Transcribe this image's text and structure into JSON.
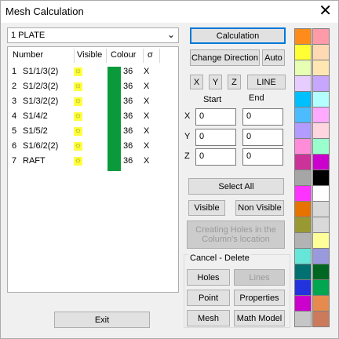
{
  "window": {
    "title": "Mesh Calculation",
    "close_symbol": "✕"
  },
  "plate_select": {
    "value": "1 PLATE"
  },
  "list": {
    "headers": {
      "number": "Number",
      "visible": "Visible",
      "colour": "Colour",
      "sigma": "σ"
    },
    "rows": [
      {
        "idx": "1",
        "name": "S1/1/3(2)",
        "colour_value": "36",
        "sigma": "X"
      },
      {
        "idx": "2",
        "name": "S1/2/3(2)",
        "colour_value": "36",
        "sigma": "X"
      },
      {
        "idx": "3",
        "name": "S1/3/2(2)",
        "colour_value": "36",
        "sigma": "X"
      },
      {
        "idx": "4",
        "name": "S1/4/2",
        "colour_value": "36",
        "sigma": "X"
      },
      {
        "idx": "5",
        "name": "S1/5/2",
        "colour_value": "36",
        "sigma": "X"
      },
      {
        "idx": "6",
        "name": "S1/6/2(2)",
        "colour_value": "36",
        "sigma": "X"
      },
      {
        "idx": "7",
        "name": "RAFT",
        "colour_value": "36",
        "sigma": "X"
      }
    ],
    "swatch_color": "#0b9a3b"
  },
  "buttons": {
    "calculation": "Calculation",
    "change_direction": "Change Direction",
    "auto": "Auto",
    "x": "X",
    "y": "Y",
    "z": "Z",
    "line": "LINE",
    "select_all": "Select All",
    "visible": "Visible",
    "non_visible": "Non Visible",
    "creating_holes": "Creating Holes in the Column's location",
    "holes": "Holes",
    "lines": "Lines",
    "point": "Point",
    "properties": "Properties",
    "mesh": "Mesh",
    "math_model": "Math Model",
    "exit": "Exit"
  },
  "coords": {
    "start_label": "Start",
    "end_label": "End",
    "x_label": "X",
    "y_label": "Y",
    "z_label": "Z",
    "x_start": "0",
    "x_end": "0",
    "y_start": "0",
    "y_end": "0",
    "z_start": "0",
    "z_end": "0"
  },
  "cancel_delete_label": "Cancel - Delete",
  "palette": [
    [
      "#ff8c1a",
      "#ff9aa8"
    ],
    [
      "#ffff33",
      "#ffd9b3"
    ],
    [
      "#e6ffb3",
      "#ffe6b3"
    ],
    [
      "#e6ccff",
      "#c6a6ff"
    ],
    [
      "#00bfff",
      "#b3ffff"
    ],
    [
      "#4dbbff",
      "#ffaaff"
    ],
    [
      "#b39cff",
      "#ffd6e0"
    ],
    [
      "#ff8cd9",
      "#99ffcc"
    ],
    [
      "#cc3399",
      "#cc00cc"
    ],
    [
      "#a6a6a6",
      "#000000"
    ],
    [
      "#ff33ff",
      "#ffffff"
    ],
    [
      "#e67300",
      "#d9d9d9"
    ],
    [
      "#999933",
      "#d9d9d9"
    ],
    [
      "#b3b3b3",
      "#ffff99"
    ],
    [
      "#66e6d9",
      "#9999dd"
    ],
    [
      "#007070",
      "#006622"
    ],
    [
      "#2233dd",
      "#00a650"
    ],
    [
      "#cc00cc",
      "#e68a4d"
    ],
    [
      "#c6c6c6",
      "#cc7a5c"
    ]
  ]
}
